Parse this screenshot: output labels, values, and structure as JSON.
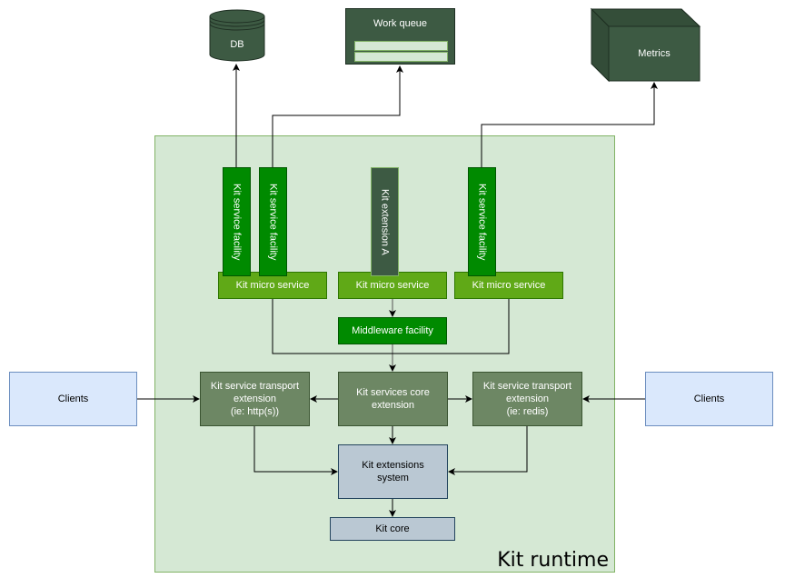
{
  "diagram": {
    "container_label": "Kit runtime",
    "external": {
      "db": "DB",
      "work_queue": "Work queue",
      "metrics": "Metrics",
      "clients_left": "Clients",
      "clients_right": "Clients"
    },
    "facilities": [
      {
        "label": "Kit service facility"
      },
      {
        "label": "Kit service facility"
      },
      {
        "label": "Kit extension A"
      },
      {
        "label": "Kit service facility"
      }
    ],
    "micro_services": [
      {
        "label": "Kit micro service"
      },
      {
        "label": "Kit micro service"
      },
      {
        "label": "Kit micro service"
      }
    ],
    "middleware": "Middleware facility",
    "transport_left": [
      "Kit service transport",
      "extension",
      "(ie: http(s))"
    ],
    "core_extension": [
      "Kit services core",
      "extension"
    ],
    "transport_right": [
      "Kit service transport",
      "extension",
      "(ie: redis)"
    ],
    "extensions_system": [
      "Kit extensions",
      "system"
    ],
    "kit_core": "Kit core",
    "colors": {
      "runtime_fill": "#d5e8d4",
      "runtime_border": "#82b366",
      "client_fill": "#dae8fc",
      "transport_fill": "#6d8764",
      "micro_service_fill": "#60a917",
      "facility_fill": "#008a00",
      "dark_fill": "#3d5a43",
      "slate_fill": "#bac8d3"
    }
  }
}
